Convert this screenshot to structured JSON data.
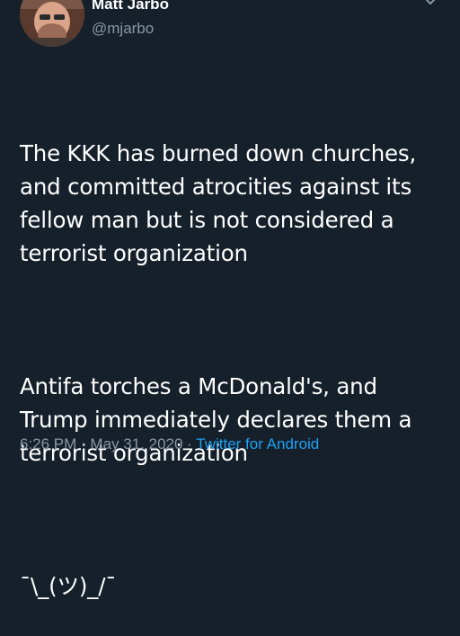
{
  "user": {
    "display_name": "Matt Jarbo",
    "handle": "@mjarbo"
  },
  "tweet": {
    "paragraph_1": "The KKK has burned down churches, and committed atrocities against its fellow man but is not considered a terrorist organization",
    "paragraph_2": "Antifa torches a McDonald's, and Trump immediately declares them a terrorist organization",
    "shrug": "¯\\_(ツ)_/¯"
  },
  "meta": {
    "time": "6:26 PM",
    "separator_1": " · ",
    "date": "May 31, 2020",
    "separator_2": " · ",
    "source": "Twitter for Android"
  },
  "icons": {
    "more": "chevron-down-icon"
  },
  "colors": {
    "background": "#15202b",
    "text": "#ffffff",
    "muted": "#8899a6",
    "link": "#1da1f2"
  }
}
